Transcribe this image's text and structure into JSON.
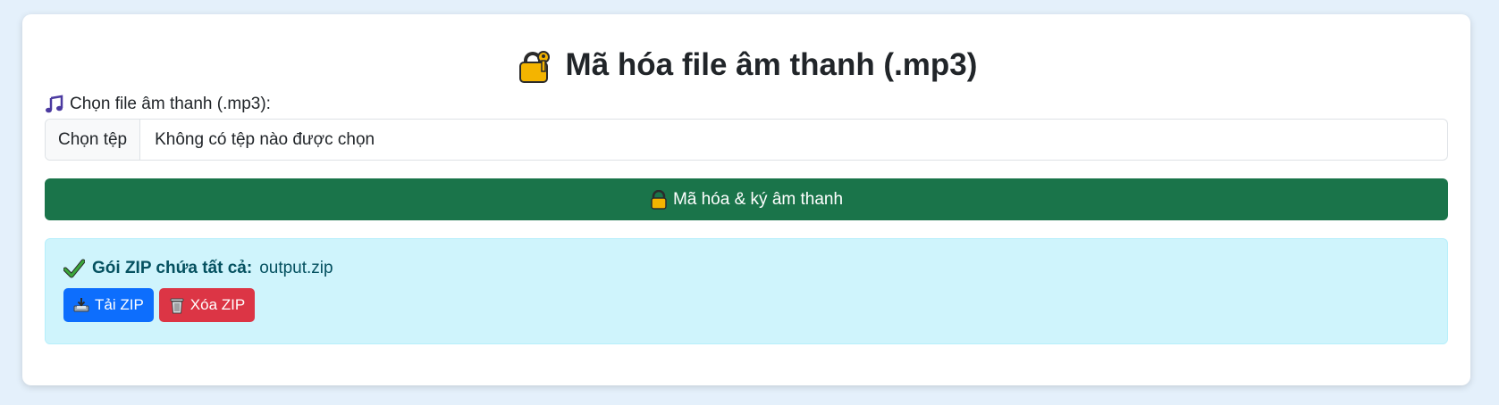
{
  "page": {
    "title": "Mã hóa file âm thanh (.mp3)",
    "title_icon": "lock-with-key-icon"
  },
  "file_field": {
    "label": "Chọn file âm thanh (.mp3):",
    "label_icon": "music-notes-icon",
    "button_label": "Chọn tệp",
    "status_text": "Không có tệp nào được chọn"
  },
  "encrypt_button": {
    "icon": "lock-icon",
    "label": "Mã hóa & ký âm thanh",
    "color": "#1a744a"
  },
  "result": {
    "icon": "check-mark-icon",
    "label": "Gói ZIP chứa tất cả:",
    "filename": "output.zip",
    "download_button": {
      "icon": "inbox-tray-icon",
      "label": "Tải ZIP",
      "color": "#0d6efd"
    },
    "delete_button": {
      "icon": "wastebasket-icon",
      "label": "Xóa ZIP",
      "color": "#dc3545"
    }
  }
}
